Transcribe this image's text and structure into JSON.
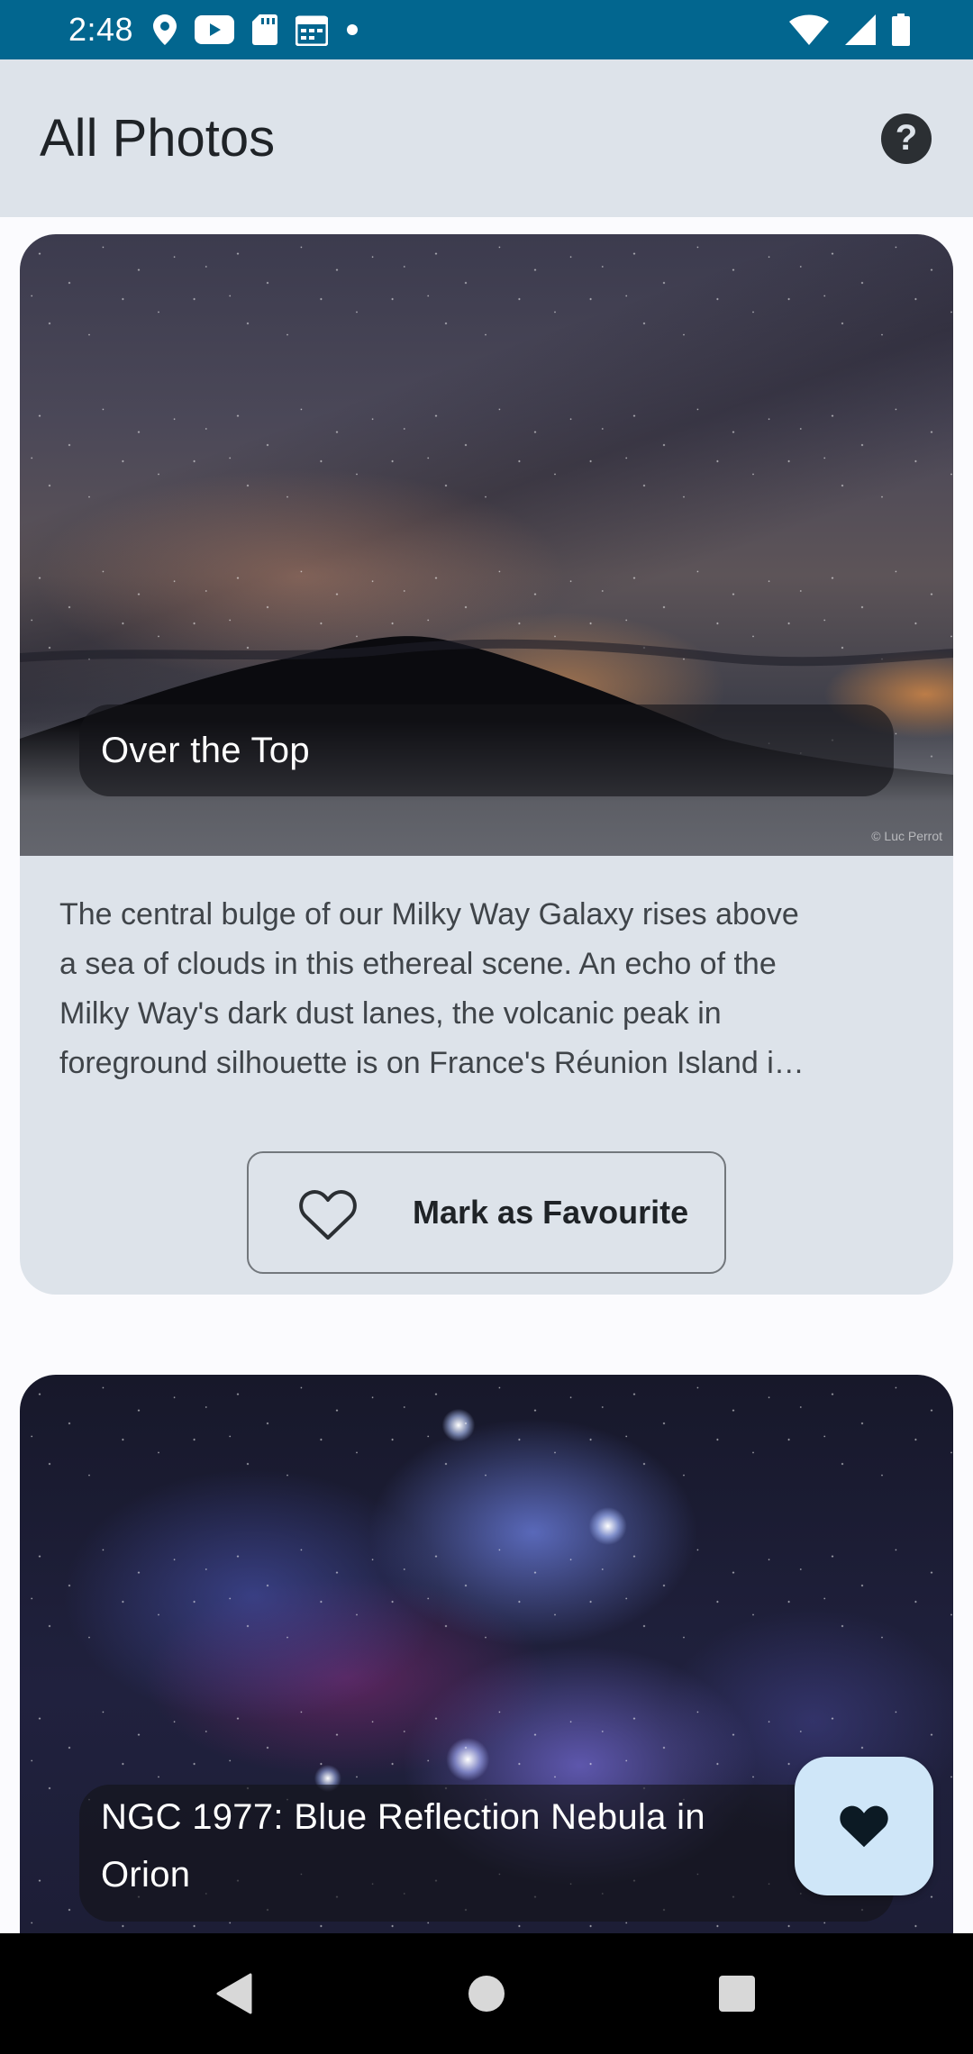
{
  "status_bar": {
    "time": "2:48",
    "icons_left": [
      "location-icon",
      "youtube-icon",
      "sd-card-icon",
      "calendar-icon",
      "dot-icon"
    ],
    "icons_right": [
      "wifi-icon",
      "signal-icon",
      "battery-icon"
    ]
  },
  "app_bar": {
    "title": "All Photos",
    "help_icon_glyph": "?"
  },
  "cards": [
    {
      "title": "Over the Top",
      "credit": "© Luc Perrot",
      "description_lines": [
        "The central bulge of our Milky Way Galaxy rises above",
        "a sea of clouds in this ethereal scene. An echo of the",
        "Milky Way's dark dust lanes, the volcanic peak in",
        "foreground silhouette is on France's Réunion Island i…"
      ],
      "favourite_label": "Mark as Favourite"
    },
    {
      "title_lines": [
        "NGC 1977: Blue Reflection Nebula in",
        "Orion"
      ]
    }
  ],
  "fab": {
    "icon": "heart-filled-icon"
  },
  "nav_bar": {
    "buttons": [
      "back",
      "home",
      "recents"
    ]
  },
  "colors": {
    "status_bar": "#02668f",
    "app_bar": "#dde3ea",
    "card": "#dde3ea",
    "fab": "#cfe6f8"
  }
}
